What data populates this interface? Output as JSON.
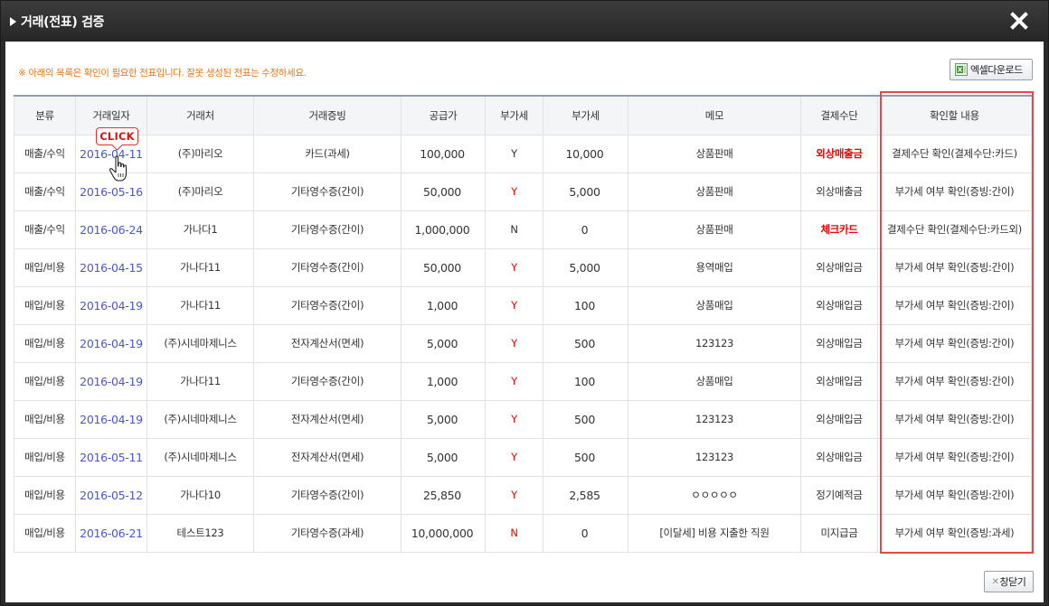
{
  "dialog": {
    "title": "거래(전표) 검증",
    "close_icon": "close-icon"
  },
  "notice": "※ 아래의 목록은 확인이 필요한 전표입니다. 잘못 생성된 전표는 수정하세요.",
  "toolbar": {
    "excel_label": "엑셀다운로드",
    "close_label": "창닫기"
  },
  "callout": {
    "label": "CLICK"
  },
  "table": {
    "columns": [
      "분류",
      "거래일자",
      "거래처",
      "거래증빙",
      "공급가",
      "부가세",
      "부가세",
      "메모",
      "결제수단",
      "확인할 내용"
    ],
    "rows": [
      {
        "category": "매출/수익",
        "date": "2016-04-11",
        "vendor": "(주)마리오",
        "evidence": "카드(과세)",
        "supply": "100,000",
        "vat_flag": "Y",
        "vat_flag_red": false,
        "vat": "10,000",
        "memo": "상품판매",
        "payment": "외상매출금",
        "payment_red": true,
        "check": "결제수단 확인(결제수단:카드)"
      },
      {
        "category": "매출/수익",
        "date": "2016-05-16",
        "vendor": "(주)마리오",
        "evidence": "기타영수증(간이)",
        "supply": "50,000",
        "vat_flag": "Y",
        "vat_flag_red": true,
        "vat": "5,000",
        "memo": "상품판매",
        "payment": "외상매출금",
        "payment_red": false,
        "check": "부가세 여부 확인(증빙:간이)"
      },
      {
        "category": "매출/수익",
        "date": "2016-06-24",
        "vendor": "가나다1",
        "evidence": "기타영수증(간이)",
        "supply": "1,000,000",
        "vat_flag": "N",
        "vat_flag_red": false,
        "vat": "0",
        "memo": "상품판매",
        "payment": "체크카드",
        "payment_red": true,
        "check": "결제수단 확인(결제수단:카드외)"
      },
      {
        "category": "매입/비용",
        "date": "2016-04-15",
        "vendor": "가나다11",
        "evidence": "기타영수증(간이)",
        "supply": "50,000",
        "vat_flag": "Y",
        "vat_flag_red": true,
        "vat": "5,000",
        "memo": "용역매입",
        "payment": "외상매입금",
        "payment_red": false,
        "check": "부가세 여부 확인(증빙:간이)"
      },
      {
        "category": "매입/비용",
        "date": "2016-04-19",
        "vendor": "가나다11",
        "evidence": "기타영수증(간이)",
        "supply": "1,000",
        "vat_flag": "Y",
        "vat_flag_red": true,
        "vat": "100",
        "memo": "상품매입",
        "payment": "외상매입금",
        "payment_red": false,
        "check": "부가세 여부 확인(증빙:간이)"
      },
      {
        "category": "매입/비용",
        "date": "2016-04-19",
        "vendor": "(주)시네마제니스",
        "evidence": "전자계산서(면세)",
        "supply": "5,000",
        "vat_flag": "Y",
        "vat_flag_red": true,
        "vat": "500",
        "memo": "123123",
        "payment": "외상매입금",
        "payment_red": false,
        "check": "부가세 여부 확인(증빙:간이)"
      },
      {
        "category": "매입/비용",
        "date": "2016-04-19",
        "vendor": "가나다11",
        "evidence": "기타영수증(간이)",
        "supply": "1,000",
        "vat_flag": "Y",
        "vat_flag_red": true,
        "vat": "100",
        "memo": "상품매입",
        "payment": "외상매입금",
        "payment_red": false,
        "check": "부가세 여부 확인(증빙:간이)"
      },
      {
        "category": "매입/비용",
        "date": "2016-04-19",
        "vendor": "(주)시네마제니스",
        "evidence": "전자계산서(면세)",
        "supply": "5,000",
        "vat_flag": "Y",
        "vat_flag_red": true,
        "vat": "500",
        "memo": "123123",
        "payment": "외상매입금",
        "payment_red": false,
        "check": "부가세 여부 확인(증빙:간이)"
      },
      {
        "category": "매입/비용",
        "date": "2016-05-11",
        "vendor": "(주)시네마제니스",
        "evidence": "전자계산서(면세)",
        "supply": "5,000",
        "vat_flag": "Y",
        "vat_flag_red": true,
        "vat": "500",
        "memo": "123123",
        "payment": "외상매입금",
        "payment_red": false,
        "check": "부가세 여부 확인(증빙:간이)"
      },
      {
        "category": "매입/비용",
        "date": "2016-05-12",
        "vendor": "가나다10",
        "evidence": "기타영수증(간이)",
        "supply": "25,850",
        "vat_flag": "Y",
        "vat_flag_red": true,
        "vat": "2,585",
        "memo": "ㅇㅇㅇㅇㅇ",
        "payment": "정기예적금",
        "payment_red": false,
        "check": "부가세 여부 확인(증빙:간이)"
      },
      {
        "category": "매입/비용",
        "date": "2016-06-21",
        "vendor": "테스트123",
        "evidence": "기타영수증(과세)",
        "supply": "10,000,000",
        "vat_flag": "N",
        "vat_flag_red": true,
        "vat": "0",
        "memo": "[이달세] 비용 지출한 직원",
        "payment": "미지급금",
        "payment_red": false,
        "check": "부가세 여부 확인(증빙:과세)"
      }
    ]
  },
  "colors": {
    "titlebar": "#2b2b2b",
    "notice": "#e8761c",
    "date_link": "#4a56d6",
    "alert_red": "#e00000",
    "highlight_border": "#e8484c"
  }
}
